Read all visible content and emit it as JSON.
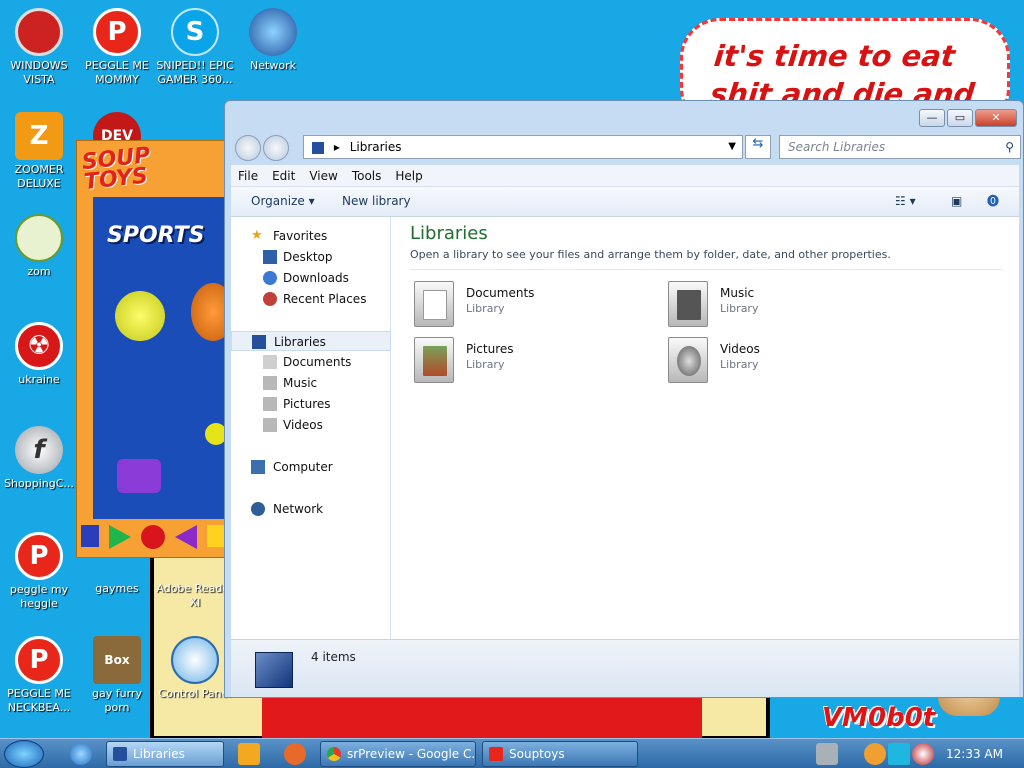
{
  "desktop": {
    "speech_text": "it's time to eat shit and die and chew",
    "watermark": "VM0b0t",
    "icons": [
      {
        "label": "WINDOWS VISTA"
      },
      {
        "label": "PEGGLE ME MOMMY"
      },
      {
        "label": "SNIPED!! EPIC GAMER 360..."
      },
      {
        "label": "Network"
      },
      {
        "label": "ZOOMER DELUXE"
      },
      {
        "label": "zom"
      },
      {
        "label": "ukraine"
      },
      {
        "label": "ShoppingC..."
      },
      {
        "label": "peggle my heggle"
      },
      {
        "label": "gaymes"
      },
      {
        "label": "Adobe Reader XI"
      },
      {
        "label": "PEGGLE ME NECKBEA..."
      },
      {
        "label": "gay furry porn"
      },
      {
        "label": "Control Panel"
      }
    ],
    "souptoys": {
      "logo": "SOUP TOYS",
      "section": "SPORTS",
      "dev_label": "DEV"
    }
  },
  "explorer": {
    "window_title": "Libraries",
    "address": {
      "path": "Libraries"
    },
    "search": {
      "placeholder": "Search Libraries"
    },
    "menu": [
      "File",
      "Edit",
      "View",
      "Tools",
      "Help"
    ],
    "toolbar": {
      "organize": "Organize ▾",
      "new_library": "New library"
    },
    "nav_pane": {
      "favorites": "Favorites",
      "favorites_items": [
        "Desktop",
        "Downloads",
        "Recent Places"
      ],
      "libraries": "Libraries",
      "libraries_items": [
        "Documents",
        "Music",
        "Pictures",
        "Videos"
      ],
      "computer": "Computer",
      "network": "Network"
    },
    "main": {
      "title": "Libraries",
      "description": "Open a library to see your files and arrange them by folder, date, and other properties.",
      "items": [
        {
          "name": "Documents",
          "type": "Library"
        },
        {
          "name": "Music",
          "type": "Library"
        },
        {
          "name": "Pictures",
          "type": "Library"
        },
        {
          "name": "Videos",
          "type": "Library"
        }
      ]
    },
    "details": {
      "count": "4 items"
    },
    "colors": {
      "title_green": "#1e6e2e",
      "chrome": "#c5dcf2"
    }
  },
  "taskbar": {
    "buttons": [
      {
        "label": "Libraries"
      },
      {
        "label": "srPreview - Google C..."
      },
      {
        "label": "Souptoys"
      }
    ],
    "clock": "12:33 AM"
  }
}
